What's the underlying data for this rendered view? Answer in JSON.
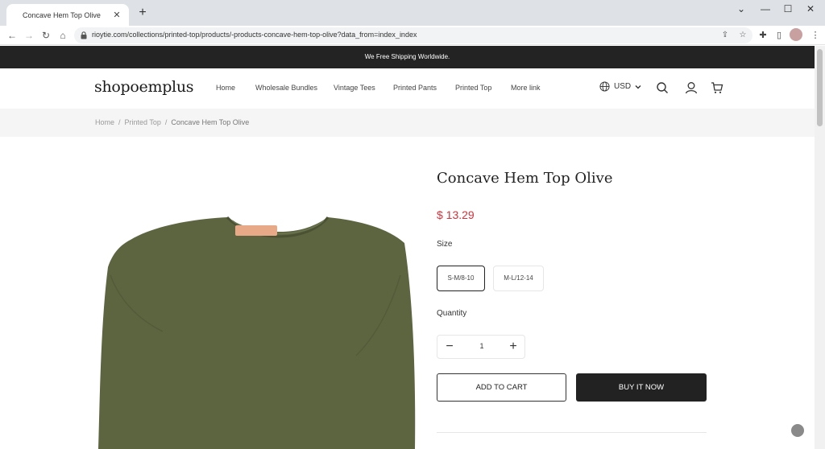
{
  "browser": {
    "tab_title": "Concave Hem Top Olive",
    "tab_close": "✕",
    "new_tab": "+",
    "url": "rioytie.com/collections/printed-top/products/-products-concave-hem-top-olive?data_from=index_index",
    "window_controls": [
      "⌄",
      "—",
      "☐",
      "✕"
    ]
  },
  "announcement": "We Free Shipping Worldwide.",
  "header": {
    "logo": "shopoemplus",
    "menu": [
      "Home",
      "Wholesale Bundles",
      "Vintage Tees",
      "Printed Pants",
      "Printed Top",
      "More link"
    ],
    "currency": "USD"
  },
  "breadcrumb": {
    "items": [
      "Home",
      "Printed Top",
      "Concave Hem Top Olive"
    ],
    "separator": "/"
  },
  "product": {
    "title": "Concave Hem Top Olive",
    "price": "$ 13.29",
    "size_label": "Size",
    "sizes": [
      "S-M/8-10",
      "M-L/12-14"
    ],
    "selected_size": "S-M/8-10",
    "quantity_label": "Quantity",
    "quantity": "1",
    "qty_minus": "−",
    "qty_plus": "+",
    "add_to_cart": "ADD TO CART",
    "buy_now": "BUY IT NOW",
    "image_color": "#5c6440"
  },
  "colors": {
    "price": "#d0343c",
    "announcement_bg": "#232323",
    "buy_now_bg": "#222222"
  }
}
